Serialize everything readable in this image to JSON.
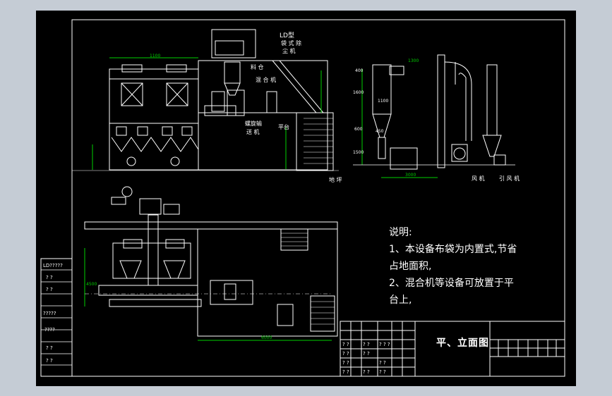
{
  "notes": {
    "heading": "说明:",
    "line1": "1、本设备布袋为内置式,节省",
    "line1b": "占地面积,",
    "line2": "2、混合机等设备可放置于平",
    "line2b": "台上,"
  },
  "title_block": {
    "title": "平、立面图"
  },
  "labels": {
    "ldm": "LD型",
    "ldm2": "袋 式 除",
    "ldm3": "尘 机",
    "bin": "料 仓",
    "mixer": "混 合 机",
    "conveyor": "螺旋输",
    "conveyor2": "送 机",
    "platform": "平台",
    "ground": "地 坪",
    "fan": "风 机",
    "outlet": "引 风 机"
  },
  "dims": [
    "1100",
    "400",
    "1600",
    "1100",
    "600",
    "450",
    "1500",
    "1300",
    "3000",
    "4500",
    "6000"
  ],
  "side_box": [
    "LD?????",
    "?  ?",
    "?  ?",
    "?????",
    "????",
    "?  ?",
    "?  ?"
  ],
  "table_cells": [
    "? ?",
    "? ?",
    "? ?",
    "? ?",
    "? ?",
    "? ?",
    "? ?",
    "? ? ?",
    "? ?",
    "? ?"
  ],
  "colors": {
    "sheet": "#000000",
    "border": "#ffffff",
    "green": "#00d000",
    "cyan": "#00c8c8",
    "line": "#ffffff"
  }
}
